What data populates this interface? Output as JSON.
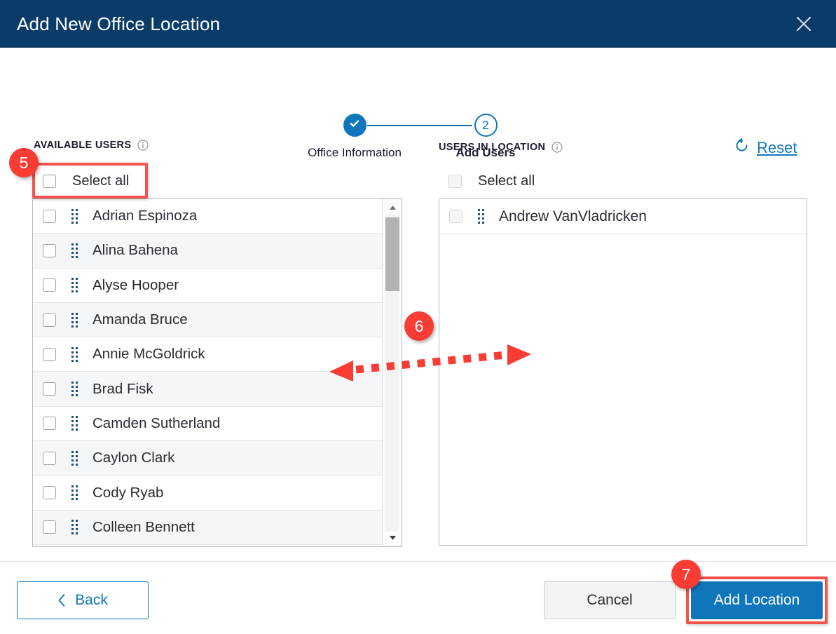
{
  "dialog": {
    "title": "Add New Office Location",
    "close_icon": "close-icon"
  },
  "stepper": {
    "steps": [
      {
        "label": "Office Information",
        "state": "completed",
        "marker": "check-icon"
      },
      {
        "label": "Add Users",
        "state": "current",
        "marker": "2"
      }
    ]
  },
  "available_panel": {
    "title": "AVAILABLE USERS",
    "info_icon": "info-icon",
    "select_all_label": "Select all",
    "select_all_checked": false,
    "users": [
      "Adrian Espinoza",
      "Alina Bahena",
      "Alyse Hooper",
      "Amanda Bruce",
      "Annie McGoldrick",
      "Brad Fisk",
      "Camden Sutherland",
      "Caylon Clark",
      "Cody Ryab",
      "Colleen Bennett"
    ]
  },
  "location_panel": {
    "title": "USERS IN LOCATION",
    "info_icon": "info-icon",
    "select_all_label": "Select all",
    "select_all_disabled": true,
    "reset_label": "Reset",
    "reset_icon": "refresh-icon",
    "users": [
      "Andrew VanVladricken"
    ]
  },
  "footer": {
    "back_label": "Back",
    "back_icon": "chevron-left-icon",
    "cancel_label": "Cancel",
    "submit_label": "Add Location"
  },
  "annotations": {
    "badge_5": "5",
    "badge_6": "6",
    "badge_7": "7"
  },
  "colors": {
    "header_navy": "#0b3c69",
    "accent_blue": "#1076bc",
    "annotation_red": "#f93c34",
    "row_alt": "#f5f6f7"
  }
}
